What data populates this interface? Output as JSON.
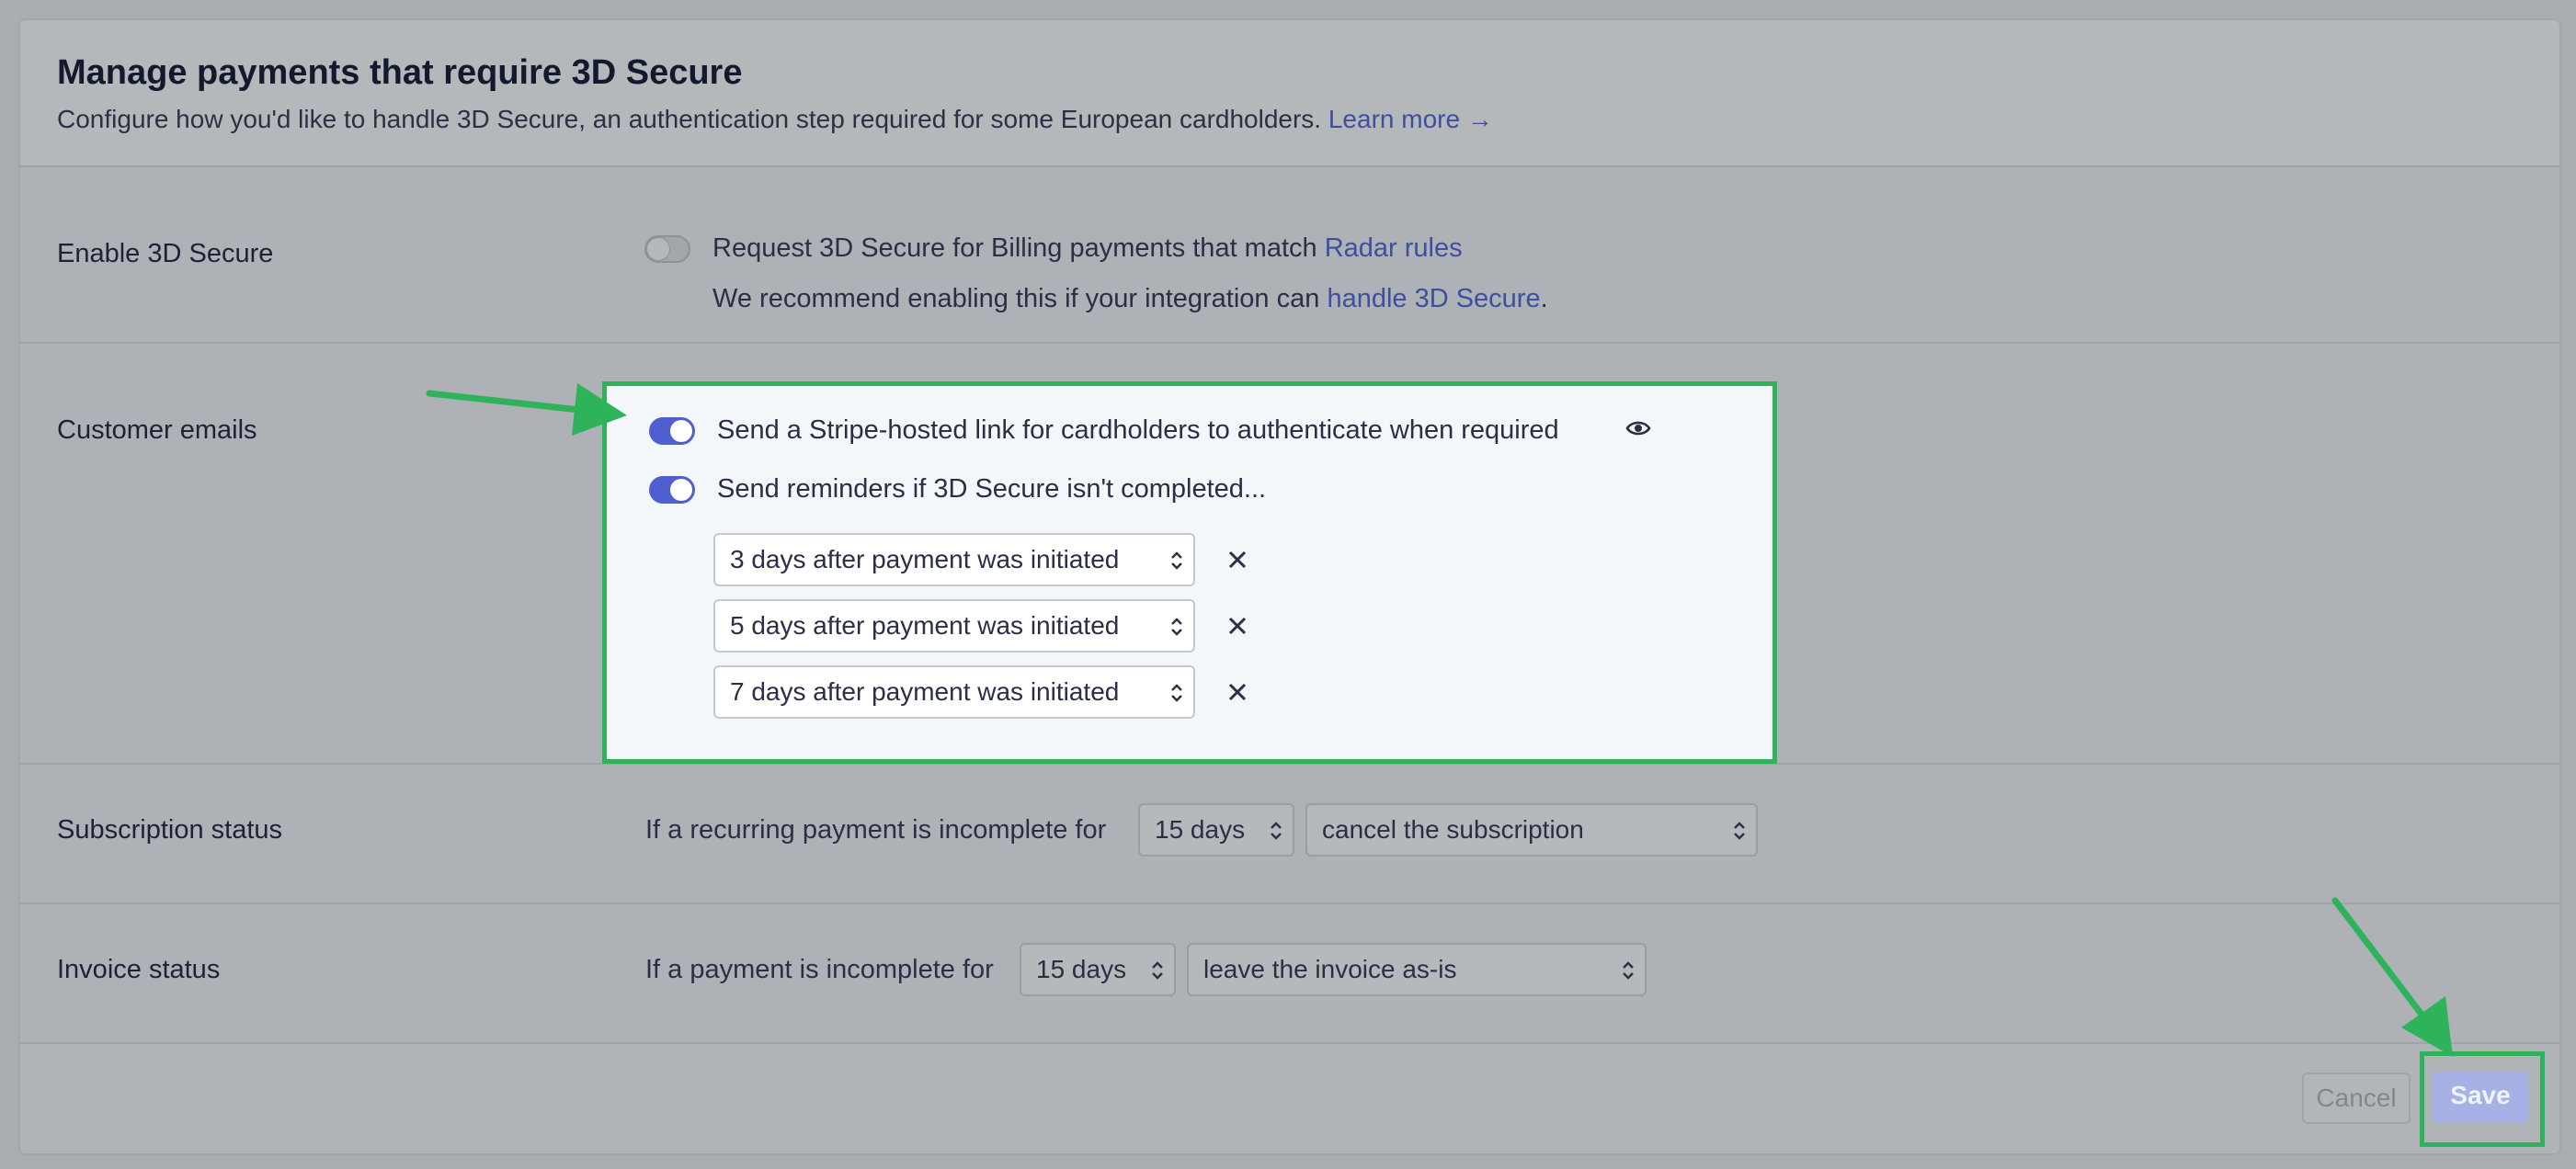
{
  "header": {
    "title": "Manage payments that require 3D Secure",
    "description": "Configure how you'd like to handle 3D Secure, an authentication step required for some European cardholders.",
    "learn_more": "Learn more →"
  },
  "enable_3ds": {
    "label": "Enable 3D Secure",
    "toggle_on": false,
    "request_text": "Request 3D Secure for Billing payments that match",
    "radar_link": "Radar rules",
    "recommend_text": "We recommend enabling this if your integration can",
    "handle_link": "handle 3D Secure",
    "recommend_end": "."
  },
  "customer_emails": {
    "label": "Customer emails",
    "hosted_link": {
      "label": "Send a Stripe-hosted link for cardholders to authenticate when required",
      "toggle_on": true,
      "preview_icon": "eye-icon"
    },
    "reminders": {
      "label": "Send reminders if 3D Secure isn't completed...",
      "toggle_on": true,
      "items": [
        {
          "value": "3 days after payment was initiated"
        },
        {
          "value": "5 days after payment was initiated"
        },
        {
          "value": "7 days after payment was initiated"
        }
      ],
      "remove_icon": "close-icon"
    }
  },
  "subscription_status": {
    "label": "Subscription status",
    "text": "If a recurring payment is incomplete for",
    "days": "15 days",
    "action": "cancel the subscription"
  },
  "invoice_status": {
    "label": "Invoice status",
    "text": "If a payment is incomplete for",
    "days": "15 days",
    "action": "leave the invoice as-is"
  },
  "footer": {
    "cancel": "Cancel",
    "save": "Save"
  },
  "colors": {
    "accent": "#4f5fd0",
    "link": "#3d4f9e",
    "highlight": "#2fb35a"
  }
}
